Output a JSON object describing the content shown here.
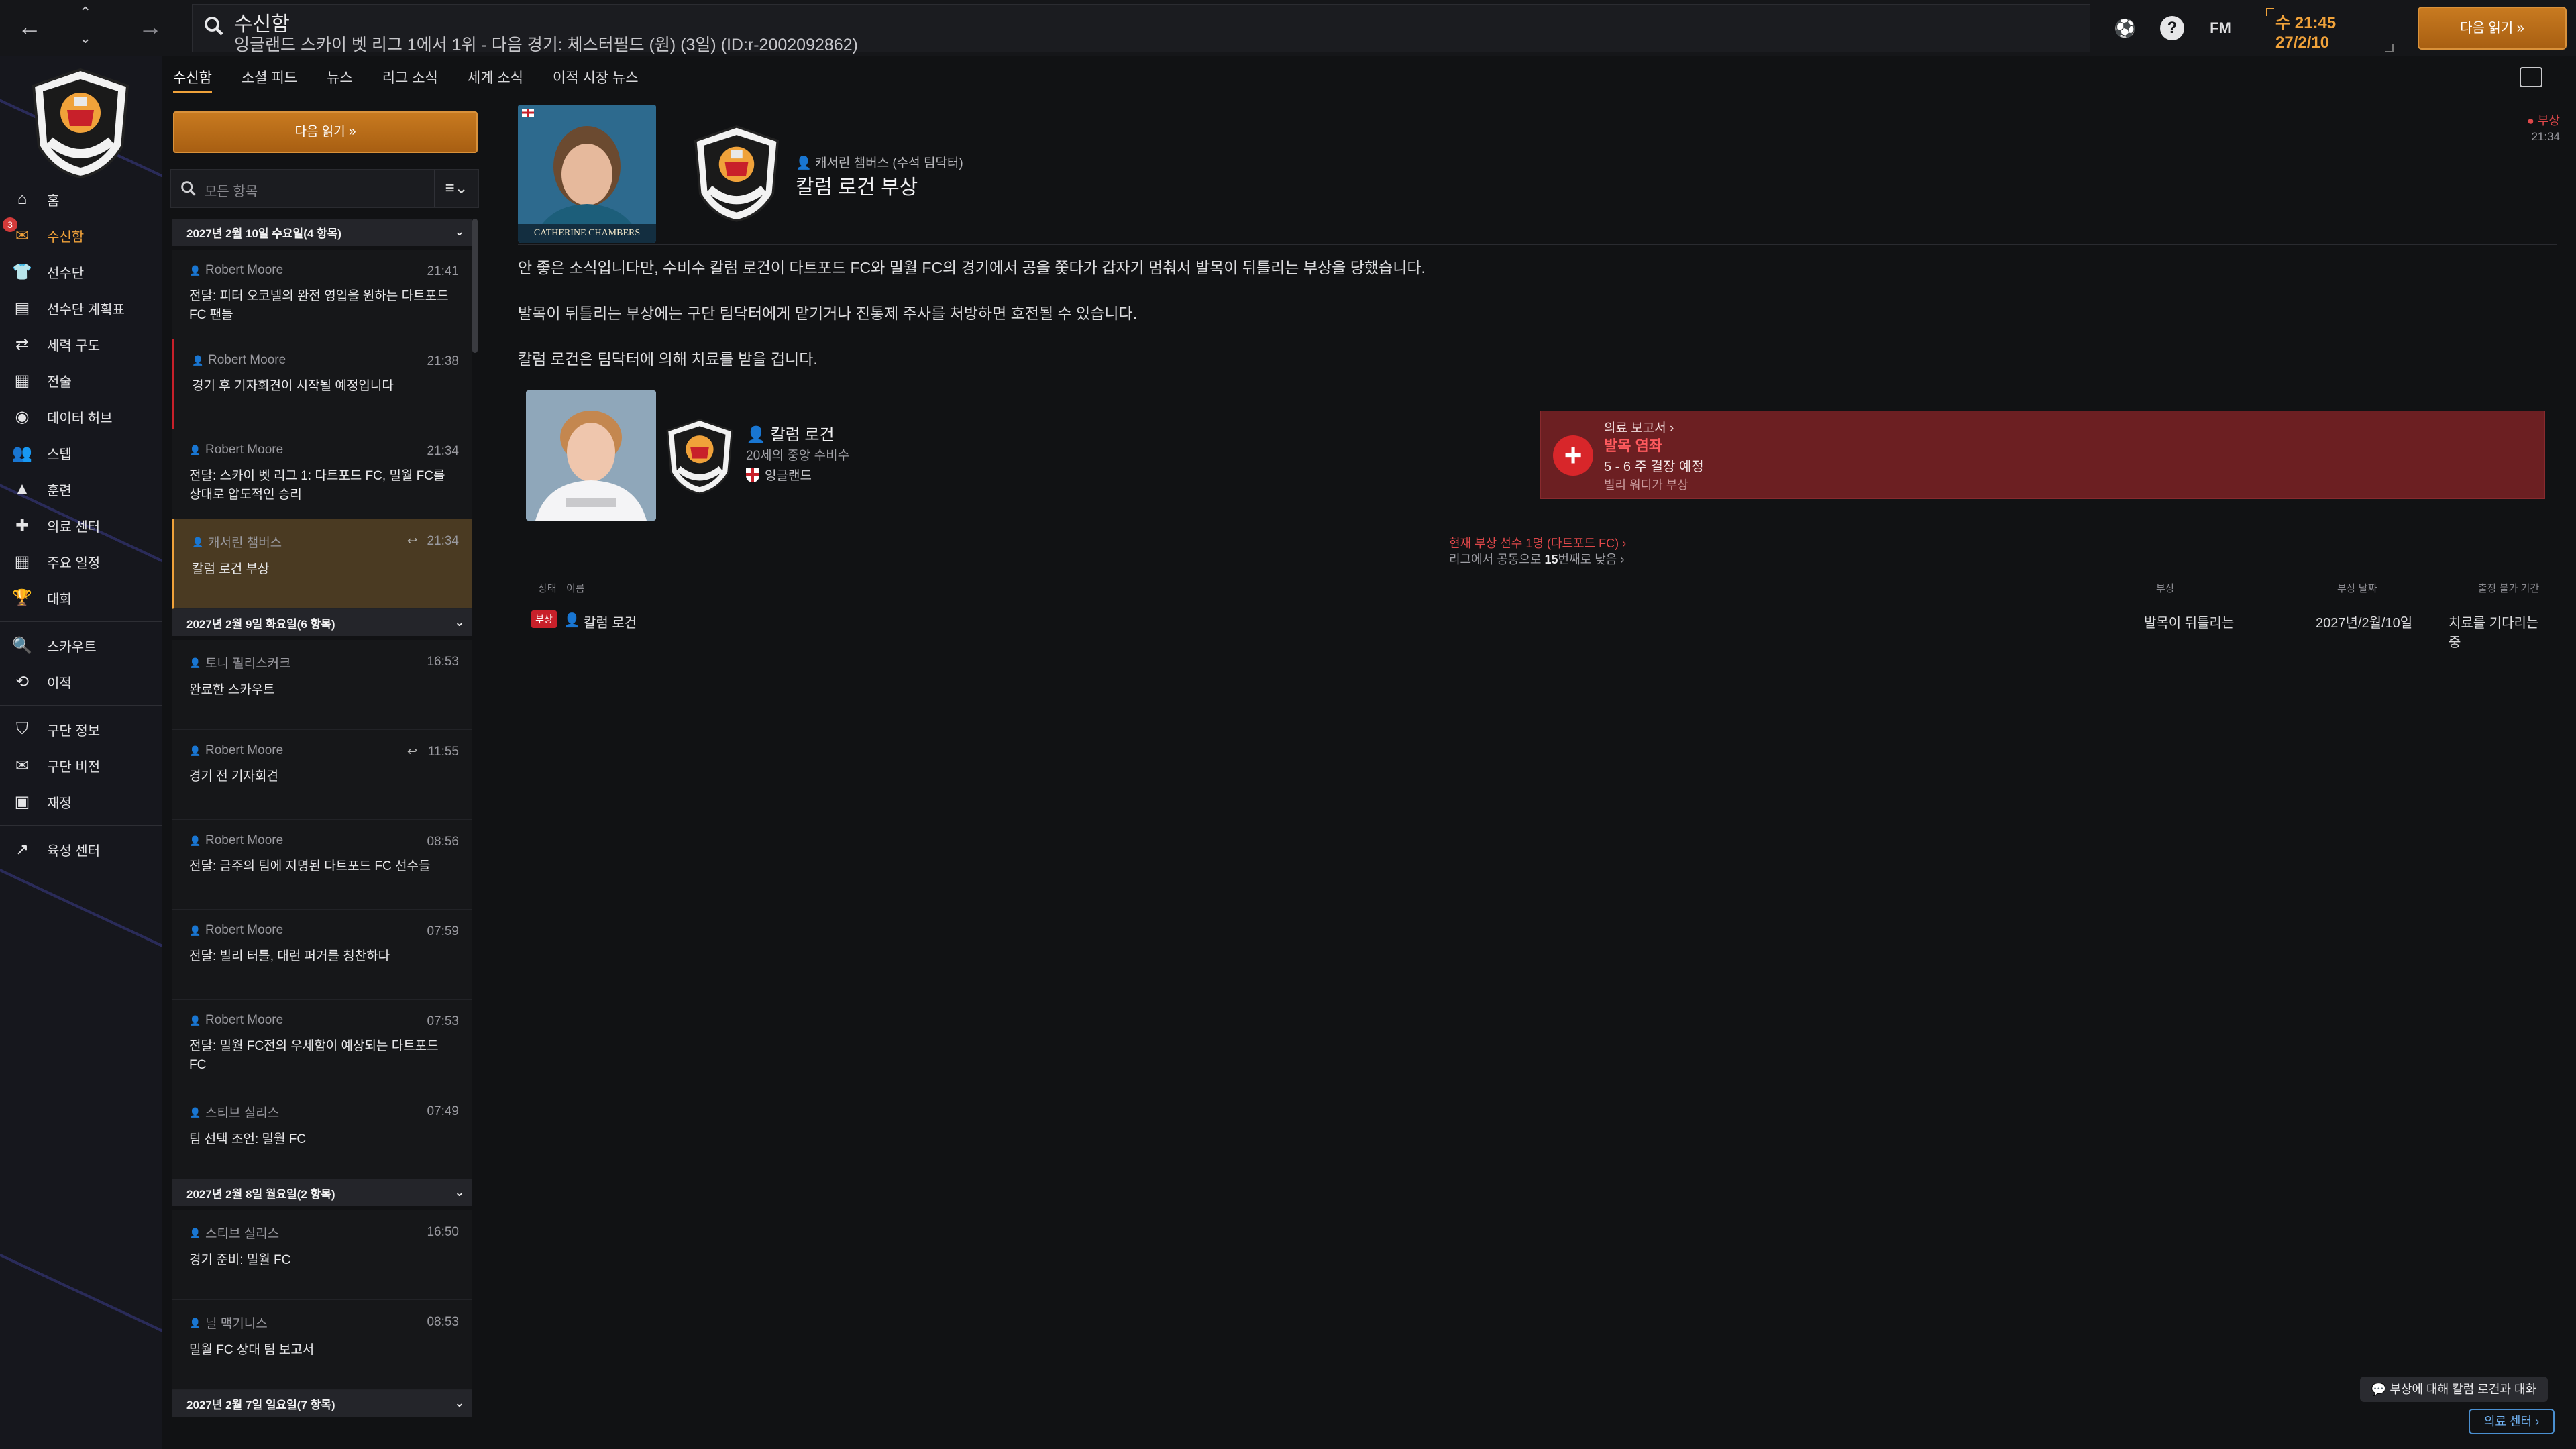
{
  "topbar": {
    "title": "수신함",
    "subtitle": "잉글랜드 스카이 벳 리그 1에서 1위 - 다음 경기: 체스터필드 (원) (3일) (ID:r-2002092862)",
    "fm_label": "FM",
    "time": "수 21:45",
    "date": "27/2/10",
    "continue_label": "다음 읽기 »"
  },
  "sidebar": {
    "inbox_badge": "3",
    "items": [
      {
        "label": "홈",
        "icon": "home-icon"
      },
      {
        "label": "수신함",
        "icon": "inbox-icon"
      },
      {
        "label": "선수단",
        "icon": "shirt-icon"
      },
      {
        "label": "선수단 계획표",
        "icon": "clipboard-icon"
      },
      {
        "label": "세력 구도",
        "icon": "dynamics-icon"
      },
      {
        "label": "전술",
        "icon": "tactics-icon"
      },
      {
        "label": "데이터 허브",
        "icon": "data-hub-icon"
      },
      {
        "label": "스텝",
        "icon": "staff-icon"
      },
      {
        "label": "훈련",
        "icon": "training-icon"
      },
      {
        "label": "의료 센터",
        "icon": "medical-icon"
      },
      {
        "label": "주요 일정",
        "icon": "calendar-icon"
      },
      {
        "label": "대회",
        "icon": "trophy-icon"
      },
      {
        "label": "스카우트",
        "icon": "scouting-icon"
      },
      {
        "label": "이적",
        "icon": "transfers-icon"
      },
      {
        "label": "구단 정보",
        "icon": "club-info-icon"
      },
      {
        "label": "구단 비전",
        "icon": "vision-icon"
      },
      {
        "label": "재정",
        "icon": "finance-icon"
      },
      {
        "label": "육성 센터",
        "icon": "development-icon"
      }
    ]
  },
  "tabs": [
    "수신함",
    "소셜 피드",
    "뉴스",
    "리그 소식",
    "세계 소식",
    "이적 시장 뉴스"
  ],
  "inbox": {
    "read_next_label": "다음 읽기 »",
    "filter_placeholder": "모든 항목",
    "filter_menu": "≡⌄",
    "groups": [
      {
        "date": "2027년 2월 10일 수요일(4 항목)",
        "messages": [
          {
            "from": "Robert Moore",
            "time": "21:41",
            "subject": "전달: 피터 오코넬의 완전 영입을 원하는 다트포드 FC 팬들"
          },
          {
            "from": "Robert Moore",
            "time": "21:38",
            "subject": "경기 후 기자회견이 시작될 예정입니다"
          },
          {
            "from": "Robert Moore",
            "time": "21:34",
            "subject": "전달: 스카이 벳 리그 1: 다트포드 FC, 밀월 FC를 상대로 압도적인 승리"
          },
          {
            "from": "캐서린 챔버스",
            "time": "21:34",
            "subject": "칼럼 로건 부상"
          }
        ]
      },
      {
        "date": "2027년 2월 9일 화요일(6 항목)",
        "messages": [
          {
            "from": "토니 필리스커크",
            "time": "16:53",
            "subject": "완료한 스카우트"
          },
          {
            "from": "Robert Moore",
            "time": "11:55",
            "subject": "경기 전 기자회견"
          },
          {
            "from": "Robert Moore",
            "time": "08:56",
            "subject": "전달: 금주의 팀에 지명된 다트포드 FC 선수들"
          },
          {
            "from": "Robert Moore",
            "time": "07:59",
            "subject": "전달: 빌리 터틀, 대런 퍼거를 칭찬하다"
          },
          {
            "from": "Robert Moore",
            "time": "07:53",
            "subject": "전달: 밀월 FC전의 우세함이 예상되는 다트포드 FC"
          },
          {
            "from": "스티브 실리스",
            "time": "07:49",
            "subject": "팀 선택 조언: 밀월 FC"
          }
        ]
      },
      {
        "date": "2027년 2월 8일 월요일(2 항목)",
        "messages": [
          {
            "from": "스티브 실리스",
            "time": "16:50",
            "subject": "경기 준비: 밀월 FC"
          },
          {
            "from": "닐 맥기니스",
            "time": "08:53",
            "subject": "밀월 FC 상대 팀 보고서"
          }
        ]
      },
      {
        "date": "2027년 2월 7일 일요일(7 항목)",
        "messages": []
      }
    ]
  },
  "message": {
    "sender": "캐서린 챔버스 (수석 팀닥터)",
    "photo_caption": "CATHERINE CHAMBERS",
    "title": "칼럼 로건 부상",
    "tag": "● 부상",
    "time": "21:34",
    "paragraphs": [
      "안 좋은 소식입니다만, 수비수 칼럼 로건이 다트포드 FC와 밀월 FC의 경기에서 공을 쫓다가 갑자기 멈춰서 발목이 뒤틀리는 부상을 당했습니다.",
      "발목이 뒤틀리는 부상에는 구단 팀닥터에게 맡기거나 진통제 주사를 처방하면 호전될 수 있습니다.",
      "칼럼 로건은 팀닥터에 의해 치료를 받을 겁니다."
    ],
    "player": {
      "name": "칼럼 로건",
      "role": "20세의 중앙 수비수",
      "nation": "잉글랜드"
    },
    "medical": {
      "link": "의료 보고서 ›",
      "diagnosis": "발목 염좌",
      "duration": "5 - 6 주 결장 예정",
      "note": "빌리 워디가 부상"
    },
    "injury_summary_1": "현재 부상 선수 1명 (다트포드 FC) ›",
    "injury_summary_2_pre": "리그에서 공동으로 ",
    "injury_summary_2_bold": "15",
    "injury_summary_2_post": "번째로 낮음 ›",
    "table_headers": [
      "상태",
      "이름",
      "부상",
      "부상 날짜",
      "출장 불가 기간"
    ],
    "table_row": {
      "status": "부상",
      "name": "칼럼 로건",
      "injury": "발목이 뒤틀리는",
      "date": "2027년/2월/10일",
      "availability": "치료를 기다리는 중"
    },
    "chat_button": "부상에 대해 칼럼 로건과 대화",
    "medical_center_button": "의료 센터 ›"
  },
  "colors": {
    "accent": "#f0a23a",
    "injury_red": "#c8202a",
    "background": "#111214"
  }
}
